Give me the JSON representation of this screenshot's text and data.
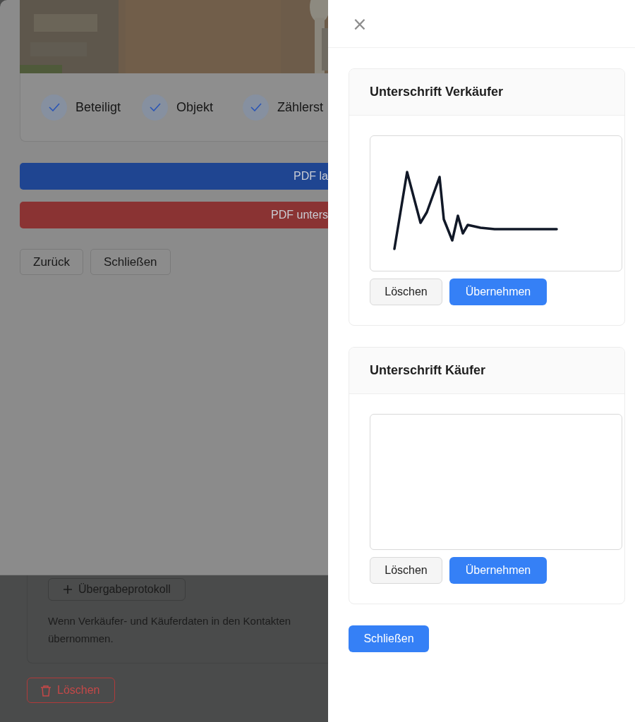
{
  "background_page": {
    "add_button": "Übergabeprotokoll",
    "note_lines": [
      "Wenn Verkäufer- und Käuferdaten in den Kontakten",
      "übernommen."
    ],
    "delete_button": "Löschen"
  },
  "modal": {
    "header_image": {
      "kind": "picture"
    },
    "steps": [
      {
        "label": "Beteiligt",
        "done": true
      },
      {
        "label": "Objekt",
        "done": true
      },
      {
        "label": "Zählerst",
        "done": true
      }
    ],
    "primary_button": "PDF la",
    "danger_button": "PDF unters",
    "footer_buttons": [
      "Zurück",
      "Schließen"
    ]
  },
  "drawer": {
    "close": "×",
    "signature_cards": [
      {
        "title": "Unterschrift Verkäufer",
        "signed": true,
        "clear_button": "Löschen",
        "apply_button": "Übernehmen"
      },
      {
        "title": "Unterschrift Käufer",
        "signed": false,
        "clear_button": "Löschen",
        "apply_button": "Übernehmen"
      }
    ],
    "close_button": "Schließen"
  }
}
